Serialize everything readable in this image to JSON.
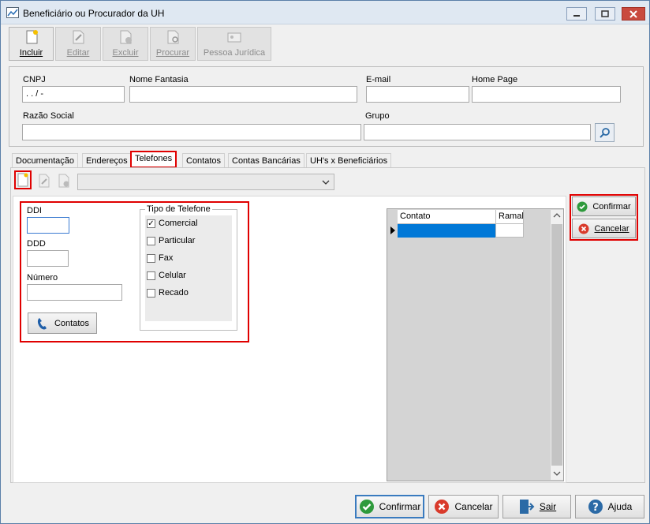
{
  "window": {
    "title": "Beneficiário ou Procurador da UH"
  },
  "toolbar": {
    "incluir": "Incluir",
    "editar": "Editar",
    "excluir": "Excluir",
    "procurar": "Procurar",
    "pessoa_juridica": "Pessoa Jurídica"
  },
  "form": {
    "cnpj_label": "CNPJ",
    "cnpj_value": " .   .   /   -",
    "nome_fantasia_label": "Nome Fantasia",
    "email_label": "E-mail",
    "home_page_label": "Home Page",
    "razao_social_label": "Razão Social",
    "grupo_label": "Grupo"
  },
  "tabs": [
    "Documentação",
    "Endereços",
    "Telefones",
    "Contatos",
    "Contas Bancárias",
    "UH's x Beneficiários"
  ],
  "phone": {
    "ddi_label": "DDI",
    "ddd_label": "DDD",
    "numero_label": "Número",
    "contatos_button": "Contatos",
    "tipo_title": "Tipo de Telefone",
    "tipos": [
      "Comercial",
      "Particular",
      "Fax",
      "Celular",
      "Recado"
    ]
  },
  "grid": {
    "col_contato": "Contato",
    "col_ramal": "Ramal"
  },
  "side": {
    "confirmar": "Confirmar",
    "cancelar": "Cancelar"
  },
  "footer": {
    "confirmar": "Confirmar",
    "cancelar": "Cancelar",
    "sair": "Sair",
    "ajuda": "Ajuda"
  },
  "colors": {
    "highlight_red": "#e00000",
    "selection_blue": "#0078d7",
    "accent_green": "#2e9a3c"
  }
}
